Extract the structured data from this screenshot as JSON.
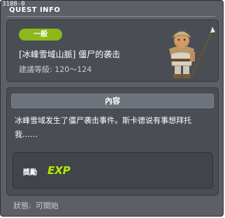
{
  "window": {
    "quest_id": "3188-0",
    "title": "QUEST INFO"
  },
  "header": {
    "badge_label": "一般",
    "quest_name": "[冰峰雪域山脈] 僵尸的袭击",
    "level_label": "建議等級:",
    "level_range": "120～124",
    "npc_icon": "hunter-npc-icon"
  },
  "content": {
    "section_title": "內容",
    "description": "冰峰雪域发生了僵尸袭击事件。斯卡德说有事想拜托我……",
    "reward_label": "獎勵",
    "reward_icon": "exp-icon",
    "reward_icon_text": "EXP"
  },
  "status": {
    "label": "狀態:",
    "value": "可開始"
  },
  "colors": {
    "window_bg": "#5c6066",
    "panel_bg": "#4a4e54",
    "badge_green": "#8cb81a",
    "exp_green": "#b6e619"
  }
}
